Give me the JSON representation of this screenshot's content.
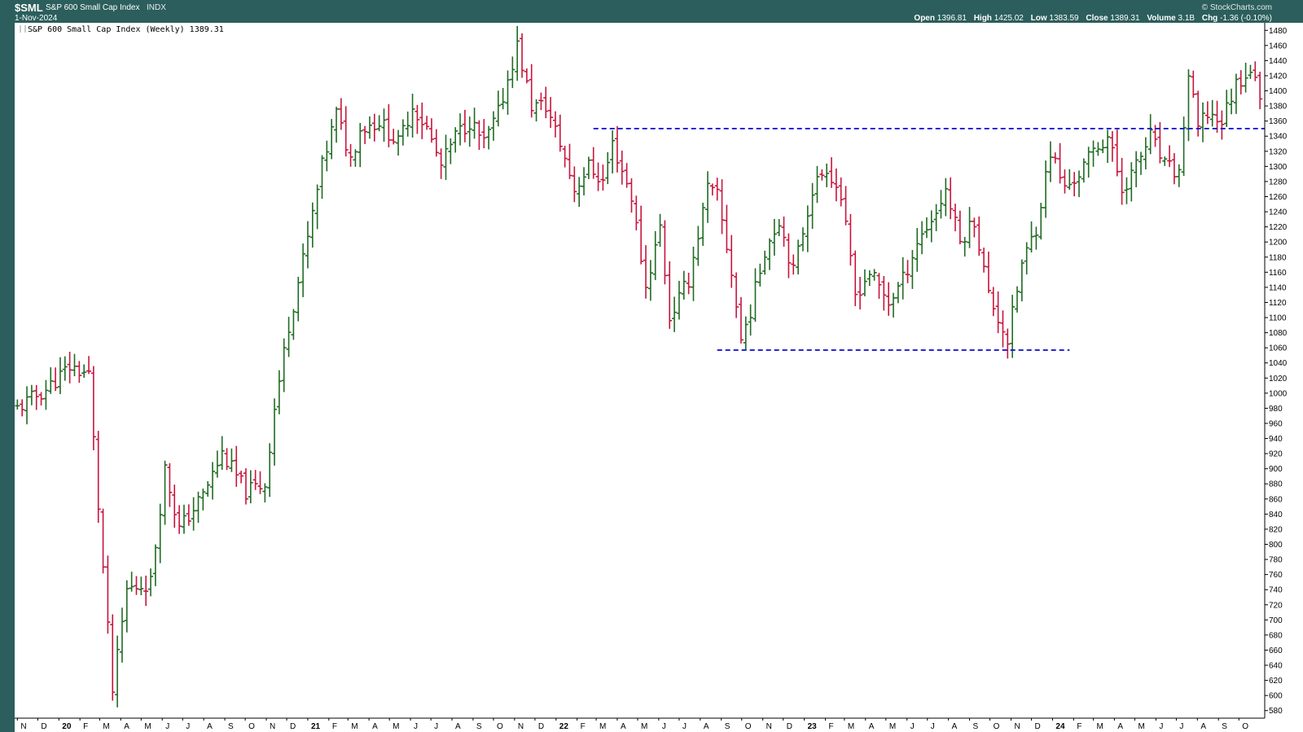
{
  "header": {
    "symbol": "$SML",
    "name": "S&P 600 Small Cap Index",
    "exchange": "INDX",
    "date": "1-Nov-2024",
    "brand": "© StockCharts.com",
    "open_label": "Open",
    "open": "1396.81",
    "high_label": "High",
    "high": "1425.02",
    "low_label": "Low",
    "low": "1383.59",
    "close_label": "Close",
    "close": "1389.31",
    "volume_label": "Volume",
    "volume": "3.1B",
    "chg_label": "Chg",
    "chg": "-1.36 (-0.10%)"
  },
  "colors": {
    "frame": "#2b5e5c",
    "up": "#1f6b22",
    "down": "#c8143c",
    "trendline": "#1a1acc"
  },
  "chart_data": {
    "type": "ohlc",
    "legend": "S&P 600 Small Cap Index (Weekly) 1389.31",
    "ylim": [
      570,
      1490
    ],
    "yticks": [
      580,
      600,
      620,
      640,
      660,
      680,
      700,
      720,
      740,
      760,
      780,
      800,
      820,
      840,
      860,
      880,
      900,
      920,
      940,
      960,
      980,
      1000,
      1020,
      1040,
      1060,
      1080,
      1100,
      1120,
      1140,
      1160,
      1180,
      1200,
      1220,
      1240,
      1260,
      1280,
      1300,
      1320,
      1340,
      1360,
      1380,
      1400,
      1420,
      1440,
      1460,
      1480
    ],
    "xlim": [
      "2019-10-28",
      "2024-11-08"
    ],
    "xticks": [
      {
        "label": "N",
        "date": "2019-11-01"
      },
      {
        "label": "D",
        "date": "2019-12-01"
      },
      {
        "label": "20",
        "date": "2020-01-01",
        "year": true
      },
      {
        "label": "F",
        "date": "2020-02-01"
      },
      {
        "label": "M",
        "date": "2020-03-01"
      },
      {
        "label": "A",
        "date": "2020-04-01"
      },
      {
        "label": "M",
        "date": "2020-05-01"
      },
      {
        "label": "J",
        "date": "2020-06-01"
      },
      {
        "label": "J",
        "date": "2020-07-01"
      },
      {
        "label": "A",
        "date": "2020-08-01"
      },
      {
        "label": "S",
        "date": "2020-09-01"
      },
      {
        "label": "O",
        "date": "2020-10-01"
      },
      {
        "label": "N",
        "date": "2020-11-01"
      },
      {
        "label": "D",
        "date": "2020-12-01"
      },
      {
        "label": "21",
        "date": "2021-01-01",
        "year": true
      },
      {
        "label": "F",
        "date": "2021-02-01"
      },
      {
        "label": "M",
        "date": "2021-03-01"
      },
      {
        "label": "A",
        "date": "2021-04-01"
      },
      {
        "label": "M",
        "date": "2021-05-01"
      },
      {
        "label": "J",
        "date": "2021-06-01"
      },
      {
        "label": "J",
        "date": "2021-07-01"
      },
      {
        "label": "A",
        "date": "2021-08-01"
      },
      {
        "label": "S",
        "date": "2021-09-01"
      },
      {
        "label": "O",
        "date": "2021-10-01"
      },
      {
        "label": "N",
        "date": "2021-11-01"
      },
      {
        "label": "D",
        "date": "2021-12-01"
      },
      {
        "label": "22",
        "date": "2022-01-01",
        "year": true
      },
      {
        "label": "F",
        "date": "2022-02-01"
      },
      {
        "label": "M",
        "date": "2022-03-01"
      },
      {
        "label": "A",
        "date": "2022-04-01"
      },
      {
        "label": "M",
        "date": "2022-05-01"
      },
      {
        "label": "J",
        "date": "2022-06-01"
      },
      {
        "label": "J",
        "date": "2022-07-01"
      },
      {
        "label": "A",
        "date": "2022-08-01"
      },
      {
        "label": "S",
        "date": "2022-09-01"
      },
      {
        "label": "O",
        "date": "2022-10-01"
      },
      {
        "label": "N",
        "date": "2022-11-01"
      },
      {
        "label": "D",
        "date": "2022-12-01"
      },
      {
        "label": "23",
        "date": "2023-01-01",
        "year": true
      },
      {
        "label": "F",
        "date": "2023-02-01"
      },
      {
        "label": "M",
        "date": "2023-03-01"
      },
      {
        "label": "A",
        "date": "2023-04-01"
      },
      {
        "label": "M",
        "date": "2023-05-01"
      },
      {
        "label": "J",
        "date": "2023-06-01"
      },
      {
        "label": "J",
        "date": "2023-07-01"
      },
      {
        "label": "A",
        "date": "2023-08-01"
      },
      {
        "label": "S",
        "date": "2023-09-01"
      },
      {
        "label": "O",
        "date": "2023-10-01"
      },
      {
        "label": "N",
        "date": "2023-11-01"
      },
      {
        "label": "D",
        "date": "2023-12-01"
      },
      {
        "label": "24",
        "date": "2024-01-01",
        "year": true
      },
      {
        "label": "F",
        "date": "2024-02-01"
      },
      {
        "label": "M",
        "date": "2024-03-01"
      },
      {
        "label": "A",
        "date": "2024-04-01"
      },
      {
        "label": "M",
        "date": "2024-05-01"
      },
      {
        "label": "J",
        "date": "2024-06-01"
      },
      {
        "label": "J",
        "date": "2024-07-01"
      },
      {
        "label": "A",
        "date": "2024-08-01"
      },
      {
        "label": "S",
        "date": "2024-09-01"
      },
      {
        "label": "O",
        "date": "2024-10-01"
      }
    ],
    "anchors": [
      [
        "2019-11-01",
        980
      ],
      [
        "2019-12-13",
        1005
      ],
      [
        "2020-01-17",
        1035
      ],
      [
        "2020-02-14",
        1025
      ],
      [
        "2020-02-28",
        850
      ],
      [
        "2020-03-20",
        605
      ],
      [
        "2020-04-10",
        740
      ],
      [
        "2020-05-15",
        750
      ],
      [
        "2020-06-05",
        900
      ],
      [
        "2020-06-26",
        820
      ],
      [
        "2020-07-31",
        865
      ],
      [
        "2020-08-28",
        920
      ],
      [
        "2020-10-02",
        870
      ],
      [
        "2020-10-30",
        880
      ],
      [
        "2020-11-13",
        980
      ],
      [
        "2020-12-04",
        1090
      ],
      [
        "2020-12-31",
        1200
      ],
      [
        "2021-01-22",
        1300
      ],
      [
        "2021-02-12",
        1370
      ],
      [
        "2021-03-05",
        1310
      ],
      [
        "2021-03-19",
        1350
      ],
      [
        "2021-04-16",
        1360
      ],
      [
        "2021-05-14",
        1330
      ],
      [
        "2021-06-04",
        1380
      ],
      [
        "2021-06-25",
        1350
      ],
      [
        "2021-07-16",
        1300
      ],
      [
        "2021-08-06",
        1340
      ],
      [
        "2021-08-27",
        1360
      ],
      [
        "2021-09-17",
        1330
      ],
      [
        "2021-10-08",
        1370
      ],
      [
        "2021-11-05",
        1460
      ],
      [
        "2021-11-26",
        1380
      ],
      [
        "2021-12-17",
        1380
      ],
      [
        "2022-01-07",
        1330
      ],
      [
        "2022-01-28",
        1270
      ],
      [
        "2022-02-18",
        1300
      ],
      [
        "2022-03-11",
        1280
      ],
      [
        "2022-03-25",
        1330
      ],
      [
        "2022-04-22",
        1260
      ],
      [
        "2022-05-13",
        1140
      ],
      [
        "2022-06-03",
        1220
      ],
      [
        "2022-06-17",
        1100
      ],
      [
        "2022-07-15",
        1150
      ],
      [
        "2022-08-12",
        1270
      ],
      [
        "2022-08-26",
        1260
      ],
      [
        "2022-09-16",
        1160
      ],
      [
        "2022-09-30",
        1070
      ],
      [
        "2022-10-14",
        1110
      ],
      [
        "2022-11-04",
        1190
      ],
      [
        "2022-11-25",
        1230
      ],
      [
        "2022-12-16",
        1160
      ],
      [
        "2023-01-13",
        1270
      ],
      [
        "2023-02-03",
        1300
      ],
      [
        "2023-02-24",
        1260
      ],
      [
        "2023-03-17",
        1130
      ],
      [
        "2023-04-07",
        1160
      ],
      [
        "2023-05-05",
        1120
      ],
      [
        "2023-05-26",
        1150
      ],
      [
        "2023-06-16",
        1200
      ],
      [
        "2023-07-14",
        1240
      ],
      [
        "2023-07-28",
        1270
      ],
      [
        "2023-08-18",
        1200
      ],
      [
        "2023-09-08",
        1230
      ],
      [
        "2023-09-29",
        1130
      ],
      [
        "2023-10-27",
        1070
      ],
      [
        "2023-11-17",
        1170
      ],
      [
        "2023-12-08",
        1220
      ],
      [
        "2023-12-29",
        1320
      ],
      [
        "2024-01-19",
        1270
      ],
      [
        "2024-02-09",
        1290
      ],
      [
        "2024-03-01",
        1320
      ],
      [
        "2024-03-22",
        1340
      ],
      [
        "2024-04-12",
        1270
      ],
      [
        "2024-05-03",
        1300
      ],
      [
        "2024-05-24",
        1340
      ],
      [
        "2024-06-14",
        1300
      ],
      [
        "2024-07-05",
        1290
      ],
      [
        "2024-07-19",
        1420
      ],
      [
        "2024-08-02",
        1350
      ],
      [
        "2024-08-16",
        1370
      ],
      [
        "2024-09-06",
        1360
      ],
      [
        "2024-09-27",
        1410
      ],
      [
        "2024-10-18",
        1430
      ],
      [
        "2024-11-01",
        1389.31
      ]
    ],
    "trendlines": [
      {
        "value": 1350,
        "from": "2022-02-25",
        "to": "2024-11-08"
      },
      {
        "value": 1057,
        "from": "2022-08-26",
        "to": "2024-01-26"
      }
    ]
  }
}
